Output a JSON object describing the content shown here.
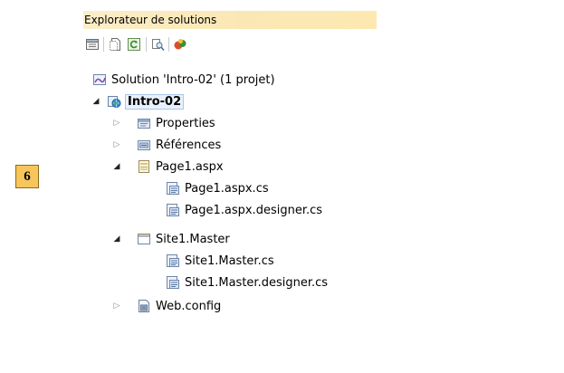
{
  "step_badge": "6",
  "panel": {
    "title": "Explorateur de solutions",
    "toolbar": [
      {
        "icon": "properties-icon"
      },
      {
        "icon": "show-all-files-icon"
      },
      {
        "icon": "refresh-icon"
      },
      {
        "icon": "view-designer-icon"
      },
      {
        "icon": "copy-website-icon"
      }
    ]
  },
  "tree": [
    {
      "label": "Solution 'Intro-02' (1 projet)",
      "icon": "solution-icon",
      "expander": "none"
    },
    {
      "label": "Intro-02",
      "icon": "web-project-icon",
      "expander": "expanded",
      "bold": true,
      "selected": true
    },
    {
      "label": "Properties",
      "icon": "properties-folder-icon",
      "expander": "collapsed"
    },
    {
      "label": "Références",
      "icon": "references-icon",
      "expander": "collapsed"
    },
    {
      "label": "Page1.aspx",
      "icon": "aspx-page-icon",
      "expander": "expanded"
    },
    {
      "label": "Page1.aspx.cs",
      "icon": "cs-file-icon",
      "expander": "none"
    },
    {
      "label": "Page1.aspx.designer.cs",
      "icon": "cs-file-icon",
      "expander": "none"
    },
    {
      "label": "Site1.Master",
      "icon": "master-page-icon",
      "expander": "expanded"
    },
    {
      "label": "Site1.Master.cs",
      "icon": "cs-file-icon",
      "expander": "none"
    },
    {
      "label": "Site1.Master.designer.cs",
      "icon": "cs-file-icon",
      "expander": "none"
    },
    {
      "label": "Web.config",
      "icon": "config-file-icon",
      "expander": "collapsed"
    }
  ]
}
